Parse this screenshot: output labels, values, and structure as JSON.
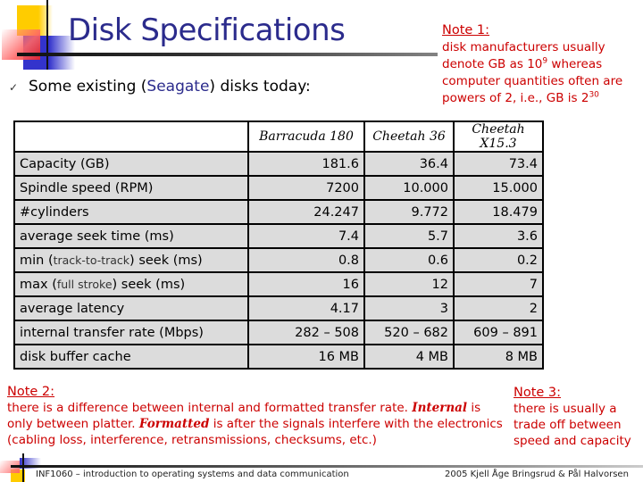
{
  "slide": {
    "title": "Disk Specifications",
    "bullet": {
      "prefix": "Some existing (",
      "accent": "Seagate",
      "suffix": ") disks today:",
      "icon": "check-icon"
    }
  },
  "note1": {
    "title": "Note 1:",
    "line1": "disk manufacturers usually",
    "line2_pre": "denote GB as 10",
    "line2_sup": "9",
    "line2_post": " whereas",
    "line3": "computer quantities often are",
    "line4_pre": "powers of 2, i.e., GB is 2",
    "line4_sup": "30"
  },
  "table": {
    "headers": [
      "",
      "Barracuda 180",
      "Cheetah 36",
      "Cheetah X15.3"
    ],
    "rows": [
      {
        "label": "Capacity (GB)",
        "values": [
          "181.6",
          "36.4",
          "73.4"
        ]
      },
      {
        "label": "Spindle speed (RPM)",
        "values": [
          "7200",
          "10.000",
          "15.000"
        ]
      },
      {
        "label": "#cylinders",
        "values": [
          "24.247",
          "9.772",
          "18.479"
        ]
      },
      {
        "label": "average seek time (ms)",
        "values": [
          "7.4",
          "5.7",
          "3.6"
        ]
      },
      {
        "label_pre": "min (",
        "label_small": "track-to-track",
        "label_post": ") seek (ms)",
        "values": [
          "0.8",
          "0.6",
          "0.2"
        ]
      },
      {
        "label_pre": "max (",
        "label_small": "full stroke",
        "label_post": ") seek (ms)",
        "values": [
          "16",
          "12",
          "7"
        ]
      },
      {
        "label": "average latency",
        "values": [
          "4.17",
          "3",
          "2"
        ]
      },
      {
        "label": "internal transfer rate (Mbps)",
        "values": [
          "282 – 508",
          "520 – 682",
          "609 – 891"
        ]
      },
      {
        "label": "disk buffer cache",
        "values": [
          "16 MB",
          "4 MB",
          "8 MB"
        ]
      }
    ]
  },
  "note2": {
    "title": "Note 2:",
    "text1": "there is a difference between internal and formatted transfer rate. ",
    "em1": "Internal",
    "text2": " is only between platter. ",
    "em2": "Formatted",
    "text3": " is after the signals interfere with the electronics (cabling loss, interference, retransmissions, checksums, etc.)"
  },
  "note3": {
    "title": "Note 3:",
    "text": "there is usually a trade off between speed and capacity"
  },
  "footer": {
    "left": "INF1060 – introduction to operating systems and data communication",
    "right": "2005  Kjell Åge Bringsrud & Pål Halvorsen"
  },
  "colors": {
    "title": "#2b2b8c",
    "note": "#cc0000",
    "cell_bg": "#dcdcdc"
  }
}
